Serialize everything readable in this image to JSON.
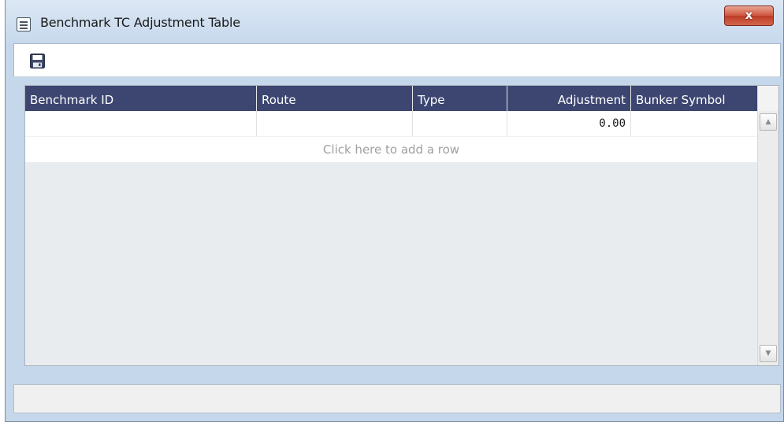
{
  "window": {
    "title": "Benchmark TC Adjustment Table",
    "close_label": "x"
  },
  "toolbar": {
    "save_icon": "floppy-disk-icon"
  },
  "table": {
    "columns": [
      "Benchmark ID",
      "Route",
      "Type",
      "Adjustment",
      "Bunker Symbol"
    ],
    "rows": [
      {
        "benchmark_id": "",
        "route": "",
        "type": "",
        "adjustment": "0.00",
        "bunker_symbol": ""
      }
    ],
    "add_row_text": "Click here to add a row"
  },
  "scrollbar": {
    "up_glyph": "▲",
    "down_glyph": "▼"
  },
  "colors": {
    "header_bg": "#3c4671",
    "title_bar": "#c7d9ed",
    "close_button": "#c9452f"
  }
}
